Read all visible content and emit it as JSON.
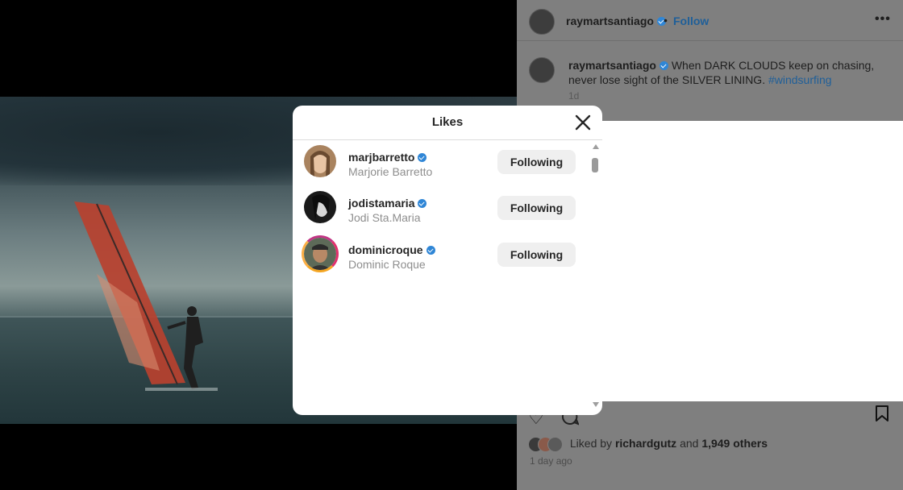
{
  "post": {
    "username": "raymartsantiago",
    "follow_label": "Follow",
    "more_label": "•••",
    "caption_username": "raymartsantiago",
    "caption_text": "When DARK CLOUDS keep on chasing, never lose sight of the SILVER LINING.",
    "caption_hashtag": "#windsurfing",
    "caption_age": "1d",
    "liked_by_prefix": "Liked by",
    "liked_by_user": "richardgutz",
    "liked_by_connector": "and",
    "liked_by_others": "1,949 others",
    "post_age": "1 day ago"
  },
  "likes_modal": {
    "title": "Likes",
    "users": [
      {
        "handle": "marjbarretto",
        "full_name": "Marjorie Barretto",
        "button": "Following",
        "verified": true
      },
      {
        "handle": "jodistamaria",
        "full_name": "Jodi Sta.Maria",
        "button": "Following",
        "verified": true
      },
      {
        "handle": "dominicroque",
        "full_name": "Dominic Roque",
        "button": "Following",
        "verified": true
      }
    ]
  },
  "icons": {
    "close": "close-icon",
    "verified": "verified-badge-icon",
    "heart": "heart-icon",
    "comment": "comment-icon",
    "save": "bookmark-icon"
  },
  "colors": {
    "verified_blue": "#2f86d6",
    "follow_link": "#1f5f99",
    "story_ring": "#e1306c"
  }
}
